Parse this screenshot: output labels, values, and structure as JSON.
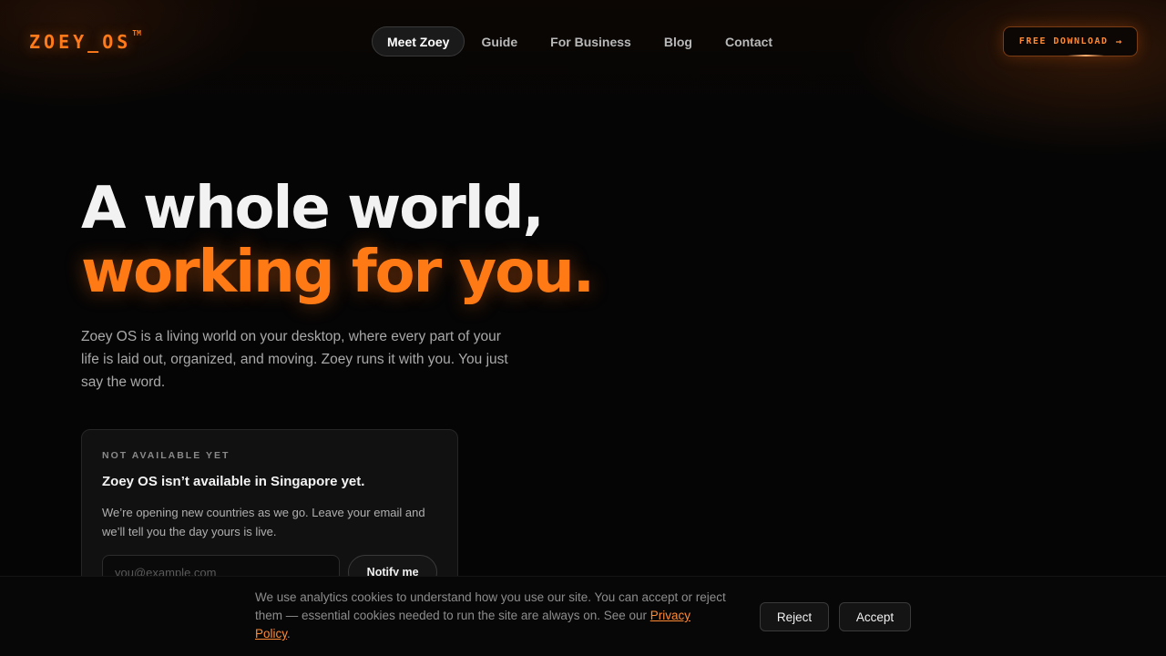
{
  "header": {
    "logo": "ZOEY_OS",
    "logo_mark": "TM",
    "nav": [
      {
        "label": "Meet Zoey",
        "active": true
      },
      {
        "label": "Guide",
        "active": false
      },
      {
        "label": "For Business",
        "active": false
      },
      {
        "label": "Blog",
        "active": false
      },
      {
        "label": "Contact",
        "active": false
      }
    ],
    "download_label": "FREE DOWNLOAD",
    "download_icon": "arrow-right-icon"
  },
  "hero": {
    "title_line1": "A whole world,",
    "title_line2": "working for you.",
    "description": "Zoey OS is a living world on your desktop, where every part of your life is laid out, organized, and moving. Zoey runs it with you. You just say the word."
  },
  "availability_card": {
    "eyebrow": "NOT AVAILABLE YET",
    "title": "Zoey OS isn’t available in Singapore yet.",
    "text": "We’re opening new countries as we go. Leave your email and we’ll tell you the day yours is live.",
    "email_placeholder": "you@example.com",
    "email_value": "",
    "notify_label": "Notify me"
  },
  "cookie_bar": {
    "text": "We use analytics cookies to understand how you use our site. You can accept or reject them — essential cookies needed to run the site are always on. See our ",
    "link_label": "Privacy Policy",
    "text_end": ".",
    "reject_label": "Reject",
    "accept_label": "Accept"
  },
  "colors": {
    "accent": "#ff7a14",
    "background": "#050505",
    "card_background": "#111112"
  }
}
